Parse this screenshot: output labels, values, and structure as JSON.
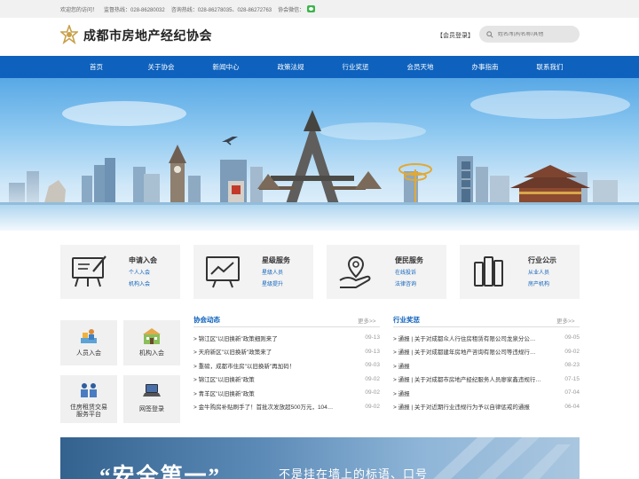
{
  "topbar": {
    "welcome": "欢迎您的访问！",
    "supervise": "监督热线：028-86280032",
    "consult": "咨询热线：028-86278035、028-86272763",
    "wechat": "协会微信："
  },
  "header": {
    "site_name": "成都市房地产经纪协会",
    "login": "【会员登录】",
    "search_placeholder": "姓名/机构名称/其他"
  },
  "nav": [
    "首页",
    "关于协会",
    "新闻中心",
    "政策法规",
    "行业奖惩",
    "会员天地",
    "办事指南",
    "联系我们"
  ],
  "features": [
    {
      "title": "申请入会",
      "l1": "个人入会",
      "l2": "机构入会",
      "icon": "presentation-board-icon"
    },
    {
      "title": "星级服务",
      "l1": "星级人员",
      "l2": "星级提升",
      "icon": "growth-chart-icon"
    },
    {
      "title": "便民服务",
      "l1": "在线投诉",
      "l2": "法律咨询",
      "icon": "location-hand-icon"
    },
    {
      "title": "行业公示",
      "l1": "从业人员",
      "l2": "房产机构",
      "icon": "books-icon"
    }
  ],
  "quick": [
    {
      "label": "人员入会",
      "icon": "person-icon"
    },
    {
      "label": "机构入会",
      "icon": "building-icon"
    },
    {
      "label": "住房租赁交易服务平台",
      "icon": "people-icon"
    },
    {
      "label": "网签登录",
      "icon": "laptop-icon"
    }
  ],
  "news": {
    "title": "协会动态",
    "more": "更多>>",
    "items": [
      {
        "t": "> 锦江区\"以旧换新\"政策细则来了",
        "d": "09-13"
      },
      {
        "t": "> 天府新区\"以旧换新\"政策来了",
        "d": "09-13"
      },
      {
        "t": "> 重磅，成都市住房\"以旧换新\"再加码！",
        "d": "09-03"
      },
      {
        "t": "> 锦江区\"以旧换新\"政策",
        "d": "09-02"
      },
      {
        "t": "> 青羊区\"以旧换新\"政策",
        "d": "09-02"
      },
      {
        "t": "> 金牛购房补贴刷手了！首批次发放超500万元，104…",
        "d": "09-02"
      }
    ]
  },
  "awards": {
    "title": "行业奖惩",
    "more": "更多>>",
    "items": [
      {
        "t": "> 通报 | 关于对成都众人行住房租赁有限公司龙泉分公…",
        "d": "09-05"
      },
      {
        "t": "> 通报 | 关于对成都建年房地产咨询有限公司等违规行…",
        "d": "09-02"
      },
      {
        "t": "> 通报",
        "d": "08-23"
      },
      {
        "t": "> 通报 | 关于对成都市房地产经纪服务人员廖家鑫违规行…",
        "d": "07-15"
      },
      {
        "t": "> 通报",
        "d": "07-04"
      },
      {
        "t": "> 通报 | 关于对近期行业违规行为予以自律惩戒的通报",
        "d": "06-04"
      }
    ]
  },
  "promo": {
    "quote": "“安全第一”",
    "sub": "不是挂在墙上的标语、口号"
  },
  "colors": {
    "brand": "#0e62bd",
    "topbar": "#f1f1f1",
    "card": "#f3f3f3"
  }
}
